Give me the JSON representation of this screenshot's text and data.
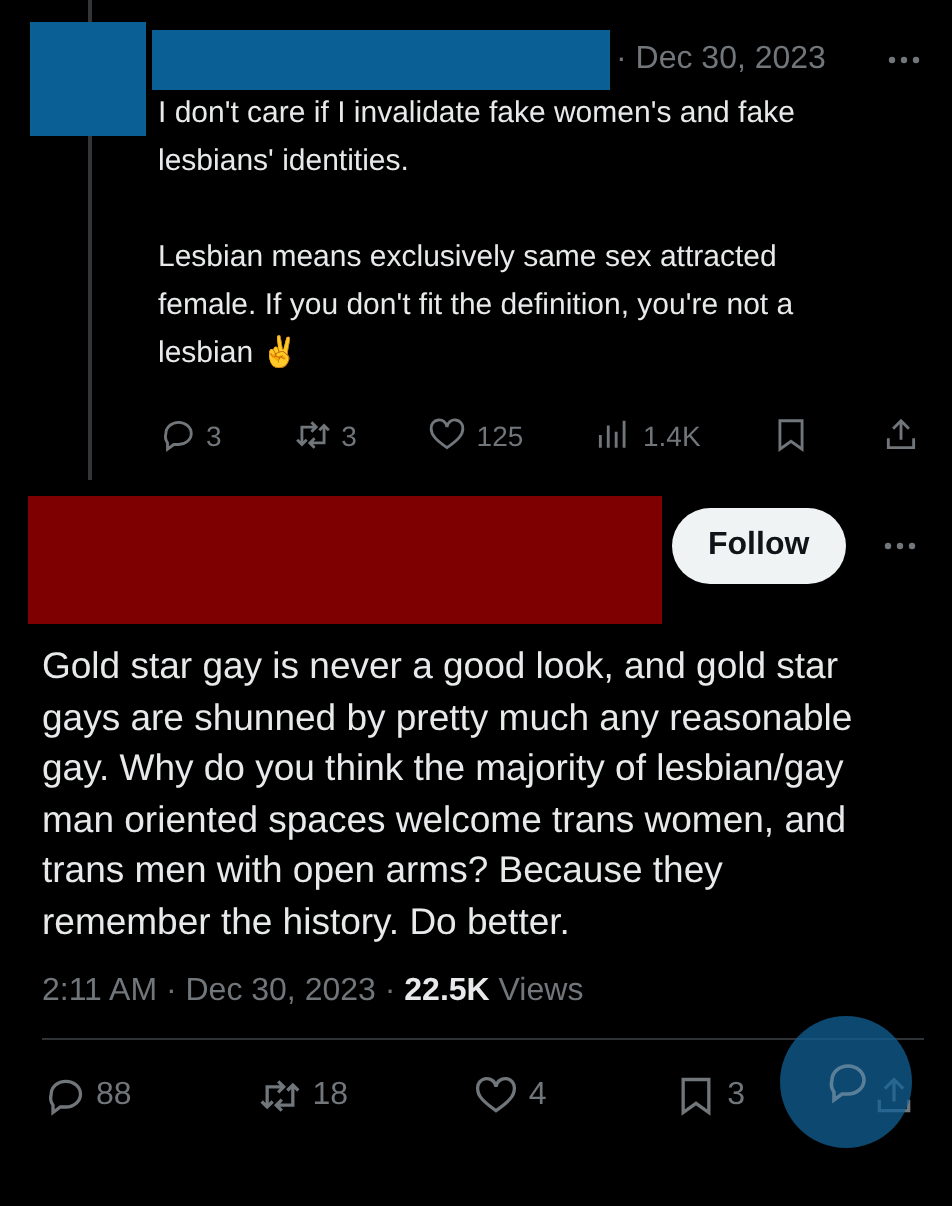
{
  "reply": {
    "date": "· Dec 30, 2023",
    "paragraphs": [
      "I don't care if I invalidate fake women's and fake lesbians' identities.",
      "Lesbian means exclusively same sex attracted female. If you don't fit the definition, you're not a lesbian ✌️"
    ],
    "actions": [
      {
        "kind": "reply",
        "count": "3"
      },
      {
        "kind": "repost",
        "count": "3"
      },
      {
        "kind": "like",
        "count": "125"
      },
      {
        "kind": "views",
        "count": "1.4K"
      },
      {
        "kind": "bookmark"
      },
      {
        "kind": "share"
      }
    ]
  },
  "tweet": {
    "follow": "Follow",
    "text": "Gold star gay is never a good look, and gold star gays are shunned by pretty much any reasonable gay. Why do you think the majority of lesbian/gay man oriented spaces welcome trans women, and trans men with open arms? Because they remember the history. Do better.",
    "time": "2:11 AM · Dec 30, 2023 ·",
    "views": "22.5K",
    "views_label": "Views",
    "actions": [
      {
        "kind": "reply",
        "count": "88"
      },
      {
        "kind": "repost",
        "count": "18"
      },
      {
        "kind": "like",
        "count": "4"
      },
      {
        "kind": "bookmark",
        "count": "3"
      },
      {
        "kind": "share"
      }
    ]
  }
}
